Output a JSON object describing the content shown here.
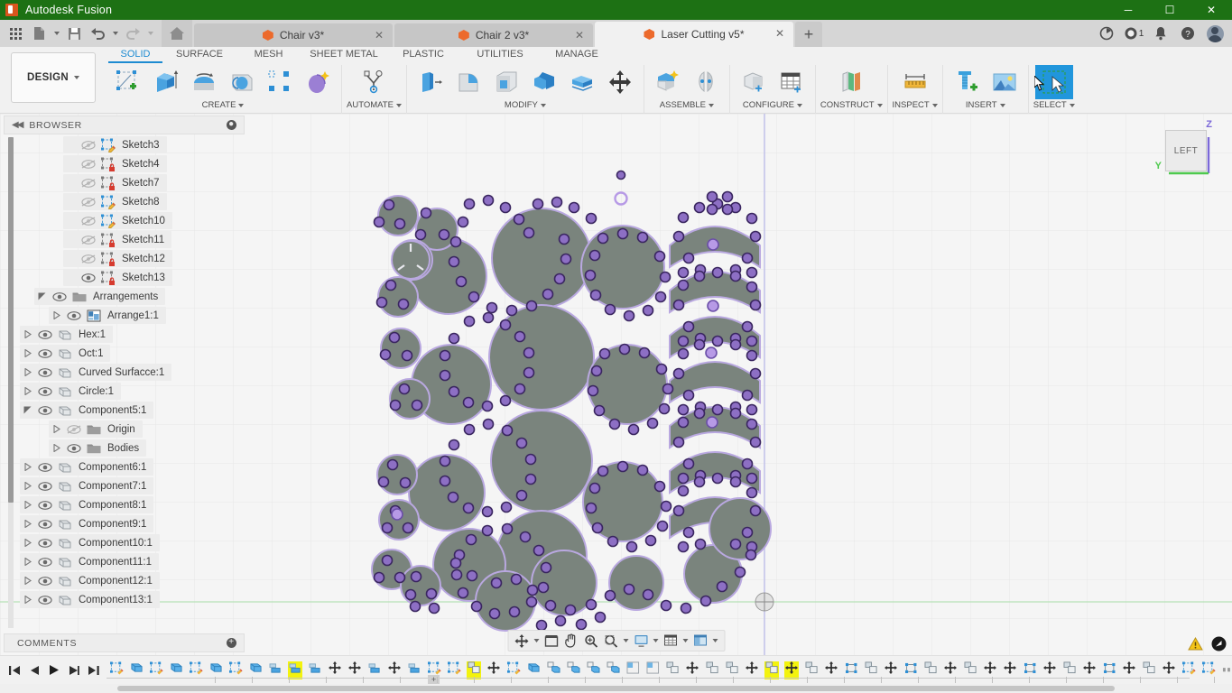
{
  "titlebar": {
    "app_title": "Autodesk Fusion",
    "logo_icon": "fusion-logo-icon",
    "minimize": "─",
    "maximize": "☐",
    "close": "✕"
  },
  "quick_access": {
    "grid_icon": "app-grid-icon",
    "new_icon": "new-document-icon",
    "save_icon": "save-icon",
    "undo_icon": "undo-icon",
    "redo_icon": "redo-icon",
    "home_icon": "home-icon"
  },
  "document_tabs": [
    {
      "label": "Chair v3*",
      "icon": "cube-icon",
      "close": "✕",
      "active": false
    },
    {
      "label": "Chair 2 v3*",
      "icon": "cube-icon",
      "close": "✕",
      "active": false
    },
    {
      "label": "Laser Cutting v5*",
      "icon": "cube-icon",
      "close": "✕",
      "active": true
    }
  ],
  "tab_add_label": "+",
  "tray": [
    {
      "name": "job-status-icon",
      "badge": ""
    },
    {
      "name": "recent-activity-icon",
      "badge": "1"
    },
    {
      "name": "notifications-bell-icon",
      "badge": ""
    },
    {
      "name": "help-icon",
      "badge": ""
    },
    {
      "name": "account-avatar",
      "badge": ""
    }
  ],
  "ribbon": {
    "workspace_label": "DESIGN",
    "tabs": [
      {
        "label": "SOLID",
        "active": true
      },
      {
        "label": "SURFACE",
        "active": false
      },
      {
        "label": "MESH",
        "active": false
      },
      {
        "label": "SHEET METAL",
        "active": false
      },
      {
        "label": "PLASTIC",
        "active": false
      },
      {
        "label": "UTILITIES",
        "active": false
      },
      {
        "label": "MANAGE",
        "active": false
      }
    ],
    "panels": [
      {
        "label": "CREATE",
        "dropdown": true,
        "tools": [
          "create-sketch-icon",
          "extrude-icon",
          "revolve-icon",
          "sweep-icon",
          "pattern-icon",
          "form-icon"
        ]
      },
      {
        "label": "AUTOMATE",
        "dropdown": true,
        "tools": [
          "automate-generative-icon"
        ]
      },
      {
        "label": "MODIFY",
        "dropdown": true,
        "tools": [
          "press-pull-icon",
          "fillet-icon",
          "shell-icon",
          "combine-icon",
          "offset-face-icon",
          "move-copy-icon"
        ]
      },
      {
        "label": "ASSEMBLE",
        "dropdown": true,
        "tools": [
          "new-component-icon",
          "joint-icon"
        ]
      },
      {
        "label": "CONFIGURE",
        "dropdown": true,
        "tools": [
          "configure-model-icon",
          "configure-table-icon"
        ]
      },
      {
        "label": "CONSTRUCT",
        "dropdown": true,
        "tools": [
          "construct-plane-icon"
        ]
      },
      {
        "label": "INSPECT",
        "dropdown": true,
        "tools": [
          "measure-icon"
        ]
      },
      {
        "label": "INSERT",
        "dropdown": true,
        "tools": [
          "insert-mcmaster-icon",
          "insert-canvas-icon"
        ]
      },
      {
        "label": "SELECT",
        "dropdown": true,
        "tools": [
          "select-window-icon"
        ],
        "selected": true
      }
    ]
  },
  "browser": {
    "header": "BROWSER",
    "collapse_icon": "collapse-panel-icon",
    "options_icon": "panel-options-icon",
    "items": [
      {
        "label": "Sketch3",
        "indent": 3,
        "expand": "none",
        "visible": false,
        "icon": "sketch-unlocked-icon"
      },
      {
        "label": "Sketch4",
        "indent": 3,
        "expand": "none",
        "visible": false,
        "icon": "sketch-locked-icon"
      },
      {
        "label": "Sketch7",
        "indent": 3,
        "expand": "none",
        "visible": false,
        "icon": "sketch-locked-icon"
      },
      {
        "label": "Sketch8",
        "indent": 3,
        "expand": "none",
        "visible": false,
        "icon": "sketch-unlocked-icon"
      },
      {
        "label": "Sketch10",
        "indent": 3,
        "expand": "none",
        "visible": false,
        "icon": "sketch-unlocked-icon"
      },
      {
        "label": "Sketch11",
        "indent": 3,
        "expand": "none",
        "visible": false,
        "icon": "sketch-locked-icon"
      },
      {
        "label": "Sketch12",
        "indent": 3,
        "expand": "none",
        "visible": false,
        "icon": "sketch-locked-icon"
      },
      {
        "label": "Sketch13",
        "indent": 3,
        "expand": "none",
        "visible": true,
        "icon": "sketch-locked-icon"
      },
      {
        "label": "Arrangements",
        "indent": 1,
        "expand": "expanded",
        "visible": true,
        "icon": "folder-icon"
      },
      {
        "label": "Arrange1:1",
        "indent": 2,
        "expand": "collapsed",
        "visible": true,
        "icon": "arrange-icon"
      },
      {
        "label": "Hex:1",
        "indent": 0,
        "expand": "collapsed",
        "visible": true,
        "icon": "component-icon"
      },
      {
        "label": "Oct:1",
        "indent": 0,
        "expand": "collapsed",
        "visible": true,
        "icon": "component-icon"
      },
      {
        "label": "Curved Surfacce:1",
        "indent": 0,
        "expand": "collapsed",
        "visible": true,
        "icon": "component-icon"
      },
      {
        "label": "Circle:1",
        "indent": 0,
        "expand": "collapsed",
        "visible": true,
        "icon": "component-icon"
      },
      {
        "label": "Component5:1",
        "indent": 0,
        "expand": "expanded",
        "visible": true,
        "icon": "component-icon"
      },
      {
        "label": "Origin",
        "indent": 2,
        "expand": "collapsed",
        "visible": false,
        "icon": "folder-icon"
      },
      {
        "label": "Bodies",
        "indent": 2,
        "expand": "collapsed",
        "visible": true,
        "icon": "folder-icon"
      },
      {
        "label": "Component6:1",
        "indent": 0,
        "expand": "collapsed",
        "visible": true,
        "icon": "component-icon"
      },
      {
        "label": "Component7:1",
        "indent": 0,
        "expand": "collapsed",
        "visible": true,
        "icon": "component-icon"
      },
      {
        "label": "Component8:1",
        "indent": 0,
        "expand": "collapsed",
        "visible": true,
        "icon": "component-icon"
      },
      {
        "label": "Component9:1",
        "indent": 0,
        "expand": "collapsed",
        "visible": true,
        "icon": "component-icon"
      },
      {
        "label": "Component10:1",
        "indent": 0,
        "expand": "collapsed",
        "visible": true,
        "icon": "component-icon"
      },
      {
        "label": "Component11:1",
        "indent": 0,
        "expand": "collapsed",
        "visible": true,
        "icon": "component-icon"
      },
      {
        "label": "Component12:1",
        "indent": 0,
        "expand": "collapsed",
        "visible": true,
        "icon": "component-icon"
      },
      {
        "label": "Component13:1",
        "indent": 0,
        "expand": "collapsed",
        "visible": true,
        "icon": "component-icon"
      }
    ]
  },
  "comments": {
    "header": "COMMENTS",
    "add_icon": "add-comment-icon"
  },
  "viewcube": {
    "face_label": "LEFT",
    "axis_z": "Z",
    "axis_y": "Y",
    "color_z": "#7b68d8",
    "color_y": "#4ec94e"
  },
  "navbar": {
    "buttons": [
      {
        "name": "orbit-icon",
        "caret": true
      },
      {
        "name": "fit-view-icon",
        "caret": false
      },
      {
        "name": "pan-hand-icon",
        "caret": false
      },
      {
        "name": "zoom-magnifier-icon",
        "caret": false
      },
      {
        "name": "zoom-window-icon",
        "caret": true
      },
      {
        "name": "display-settings-icon",
        "caret": true
      },
      {
        "name": "grid-snaps-icon",
        "caret": true
      },
      {
        "name": "viewports-icon",
        "caret": true
      }
    ]
  },
  "status": {
    "warning_icon": "warning-triangle-icon",
    "notify_icon": "error-badge-icon"
  },
  "timeline": {
    "playback": [
      "go-to-beginning-icon",
      "step-back-icon",
      "play-icon",
      "step-forward-icon",
      "go-to-end-icon"
    ],
    "features": [
      {
        "icon": "sketch-icon",
        "hl": false
      },
      {
        "icon": "extrude-icon",
        "hl": false
      },
      {
        "icon": "sketch-icon",
        "hl": false
      },
      {
        "icon": "extrude-icon",
        "hl": false
      },
      {
        "icon": "sketch-icon",
        "hl": false
      },
      {
        "icon": "extrude-icon",
        "hl": false
      },
      {
        "icon": "sketch-icon",
        "hl": false
      },
      {
        "icon": "extrude-icon",
        "hl": false
      },
      {
        "icon": "align-icon",
        "hl": false
      },
      {
        "icon": "align-icon",
        "hl": true
      },
      {
        "icon": "align-icon",
        "hl": false
      },
      {
        "icon": "move-icon",
        "hl": false
      },
      {
        "icon": "move-icon",
        "hl": false
      },
      {
        "icon": "align-icon",
        "hl": false
      },
      {
        "icon": "move-icon",
        "hl": false
      },
      {
        "icon": "align-icon",
        "hl": false
      },
      {
        "icon": "sketch-icon",
        "hl": false
      },
      {
        "icon": "sketch-icon",
        "hl": false
      },
      {
        "icon": "copy-paste-icon",
        "hl": true
      },
      {
        "icon": "move-icon",
        "hl": false
      },
      {
        "icon": "sketch-icon",
        "hl": false
      },
      {
        "icon": "extrude-icon",
        "hl": false
      },
      {
        "icon": "component-copy-icon",
        "hl": false
      },
      {
        "icon": "component-copy-icon",
        "hl": false
      },
      {
        "icon": "component-copy-icon",
        "hl": false
      },
      {
        "icon": "component-copy-icon",
        "hl": false
      },
      {
        "icon": "mirror-icon",
        "hl": false
      },
      {
        "icon": "mirror-icon",
        "hl": false
      },
      {
        "icon": "copy-paste-icon",
        "hl": false
      },
      {
        "icon": "move-icon",
        "hl": false
      },
      {
        "icon": "copy-paste-icon",
        "hl": false
      },
      {
        "icon": "copy-paste-icon",
        "hl": false
      },
      {
        "icon": "move-icon",
        "hl": false
      },
      {
        "icon": "copy-paste-icon",
        "hl": true
      },
      {
        "icon": "move-icon",
        "hl": true
      },
      {
        "icon": "copy-paste-icon",
        "hl": false
      },
      {
        "icon": "move-icon",
        "hl": false
      },
      {
        "icon": "pattern-icon",
        "hl": false
      },
      {
        "icon": "copy-paste-icon",
        "hl": false
      },
      {
        "icon": "move-icon",
        "hl": false
      },
      {
        "icon": "pattern-icon",
        "hl": false
      },
      {
        "icon": "copy-paste-icon",
        "hl": false
      },
      {
        "icon": "move-icon",
        "hl": false
      },
      {
        "icon": "copy-paste-icon",
        "hl": false
      },
      {
        "icon": "move-icon",
        "hl": false
      },
      {
        "icon": "move-icon",
        "hl": false
      },
      {
        "icon": "pattern-icon",
        "hl": false
      },
      {
        "icon": "move-icon",
        "hl": false
      },
      {
        "icon": "copy-paste-icon",
        "hl": false
      },
      {
        "icon": "move-icon",
        "hl": false
      },
      {
        "icon": "pattern-icon",
        "hl": false
      },
      {
        "icon": "move-icon",
        "hl": false
      },
      {
        "icon": "copy-paste-icon",
        "hl": false
      },
      {
        "icon": "move-icon",
        "hl": false
      },
      {
        "icon": "sketch-icon",
        "hl": false
      },
      {
        "icon": "sketch-icon",
        "hl": false
      },
      {
        "icon": "dots-icon",
        "hl": false
      },
      {
        "icon": "arrange-icon",
        "hl": false
      },
      {
        "icon": "sketch-icon",
        "hl": false
      },
      {
        "icon": "sketch-dim-icon",
        "hl": false
      }
    ],
    "add_marker": "+",
    "settings_icon": "timeline-settings-icon"
  }
}
